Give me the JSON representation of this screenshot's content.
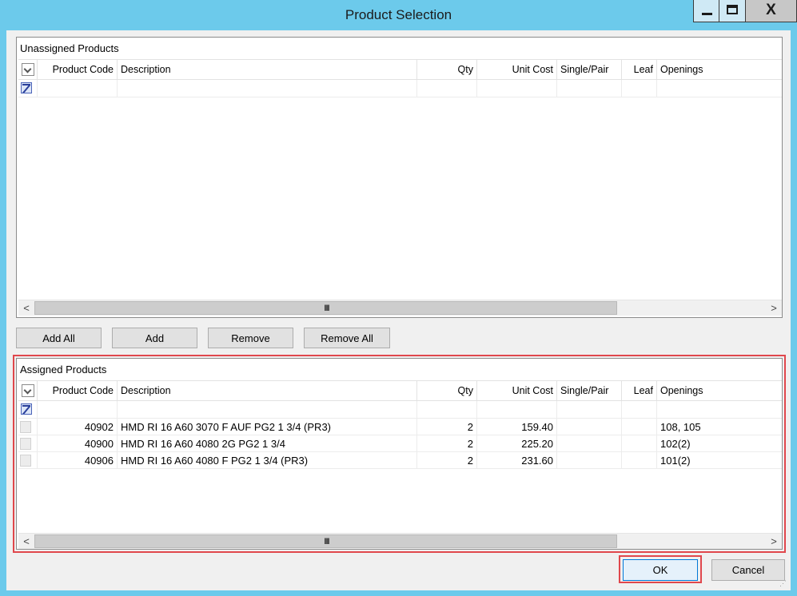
{
  "window": {
    "title": "Product Selection",
    "controls": {
      "minimize": "minimize-icon",
      "maximize": "maximize-icon",
      "close": "close-icon"
    }
  },
  "unassigned": {
    "caption": "Unassigned Products",
    "columns": [
      "Product Code",
      "Description",
      "Qty",
      "Unit Cost",
      "Single/Pair",
      "Leaf",
      "Openings"
    ],
    "rows": []
  },
  "actions": {
    "add_all": "Add All",
    "add": "Add",
    "remove": "Remove",
    "remove_all": "Remove All"
  },
  "assigned": {
    "caption": "Assigned Products",
    "columns": [
      "Product Code",
      "Description",
      "Qty",
      "Unit Cost",
      "Single/Pair",
      "Leaf",
      "Openings"
    ],
    "rows": [
      {
        "code": "40902",
        "description": "HMD RI 16 A60 3070 F AUF PG2 1 3/4 (PR3)",
        "qty": "2",
        "unit_cost": "159.40",
        "single_pair": "",
        "leaf": "",
        "openings": "108, 105"
      },
      {
        "code": "40900",
        "description": "HMD RI 16 A60 4080 2G PG2 1 3/4",
        "qty": "2",
        "unit_cost": "225.20",
        "single_pair": "",
        "leaf": "",
        "openings": "102(2)"
      },
      {
        "code": "40906",
        "description": "HMD RI 16 A60 4080 F PG2 1 3/4 (PR3)",
        "qty": "2",
        "unit_cost": "231.60",
        "single_pair": "",
        "leaf": "",
        "openings": "101(2)"
      }
    ]
  },
  "scrollbar": {
    "left_arrow": "<",
    "right_arrow": ">",
    "grip": "III"
  },
  "footer": {
    "ok": "OK",
    "cancel": "Cancel"
  },
  "colors": {
    "titlebar": "#6ccaeb",
    "highlight": "#e0474c",
    "ok_border": "#0078d7"
  }
}
